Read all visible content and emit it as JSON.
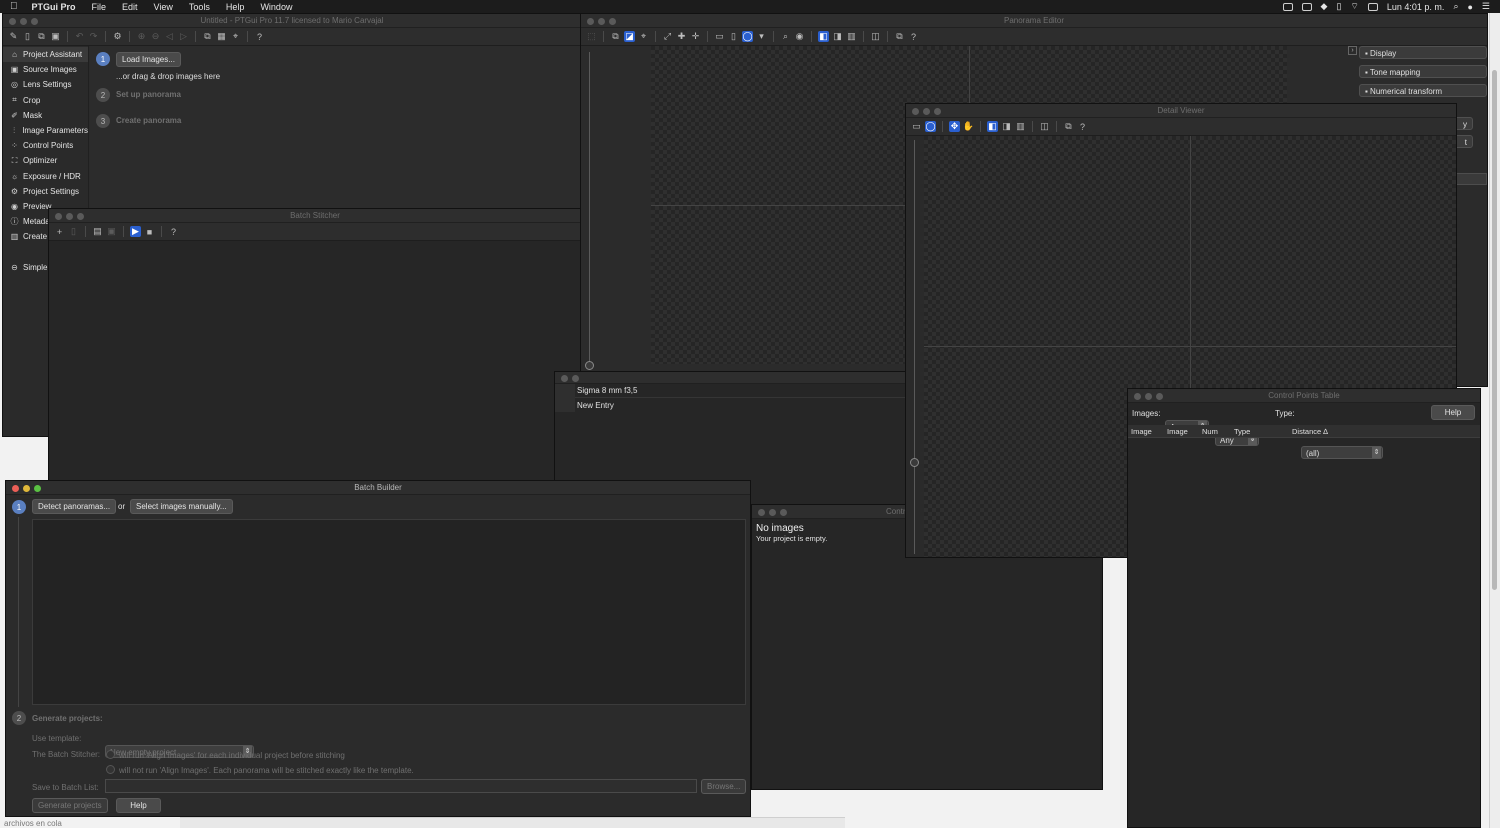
{
  "menubar": {
    "app": "PTGui Pro",
    "items": [
      "File",
      "Edit",
      "View",
      "Tools",
      "Help",
      "Window"
    ],
    "clock": "Lun 4:01 p. m."
  },
  "main_window": {
    "title": "Untitled - PTGui Pro 11.7 licensed to Mario Carvajal",
    "sidebar": [
      {
        "label": "Project Assistant",
        "icon": "home-icon"
      },
      {
        "label": "Source Images",
        "icon": "images-icon"
      },
      {
        "label": "Lens Settings",
        "icon": "lens-icon"
      },
      {
        "label": "Crop",
        "icon": "crop-icon"
      },
      {
        "label": "Mask",
        "icon": "mask-icon"
      },
      {
        "label": "Image Parameters",
        "icon": "parameters-icon"
      },
      {
        "label": "Control Points",
        "icon": "control-points-icon"
      },
      {
        "label": "Optimizer",
        "icon": "optimizer-icon"
      },
      {
        "label": "Exposure / HDR",
        "icon": "exposure-icon"
      },
      {
        "label": "Project Settings",
        "icon": "settings-icon"
      },
      {
        "label": "Preview",
        "icon": "eye-icon"
      },
      {
        "label": "Metada",
        "icon": "info-icon"
      },
      {
        "label": "Create",
        "icon": "book-icon"
      }
    ],
    "simple_label": "Simple",
    "assistant": {
      "step1": "1",
      "load_button": "Load Images...",
      "drag_hint": "...or drag & drop images here",
      "step2": "2",
      "step2_label": "Set up panorama",
      "step3": "3",
      "step3_label": "Create panorama"
    }
  },
  "batch_stitcher": {
    "title": "Batch Stitcher"
  },
  "panorama_editor": {
    "title": "Panorama Editor",
    "panels": [
      "▪ Display",
      "▪ Tone mapping",
      "▪ Numerical transform"
    ],
    "partial_y": "y",
    "partial_t": "t"
  },
  "detail_viewer": {
    "title": "Detail Viewer"
  },
  "lens_list": {
    "items": [
      "Sigma 8 mm f3,5",
      "New Entry"
    ]
  },
  "control_points_table": {
    "title": "Control Points Table",
    "images_label": "Images:",
    "image_a": "Any",
    "image_b": "Any",
    "type_label": "Type:",
    "type_value": "(all)",
    "help": "Help",
    "columns": [
      "Image",
      "Image",
      "Num",
      "Type",
      "Distance ∆"
    ]
  },
  "control_points_window": {
    "title_partial": "Contr",
    "no_images": "No images",
    "empty": "Your project is empty."
  },
  "batch_builder": {
    "title": "Batch Builder",
    "step1": "1",
    "detect_button": "Detect panoramas...",
    "or": "or",
    "select_button": "Select images manually...",
    "step2": "2",
    "generate_heading": "Generate projects:",
    "use_template_label": "Use template:",
    "template_value": "New empty project",
    "stitcher_label": "The Batch Stitcher:",
    "radio1": "will run 'Align Images' for each individual project before stitching",
    "radio2": "will not run 'Align Images'. Each panorama will be stitched exactly like the template.",
    "save_label": "Save to Batch List:",
    "browse": "Browse...",
    "generate_button": "Generate projects",
    "help_button": "Help"
  },
  "desktop": {
    "watermark": "archivos en cola"
  },
  "colors": {
    "accent": "#2a5fcf",
    "window_bg": "#2b2b2b",
    "close": "#ec5f57",
    "minimize": "#e0b83a",
    "zoom": "#5ac143"
  }
}
